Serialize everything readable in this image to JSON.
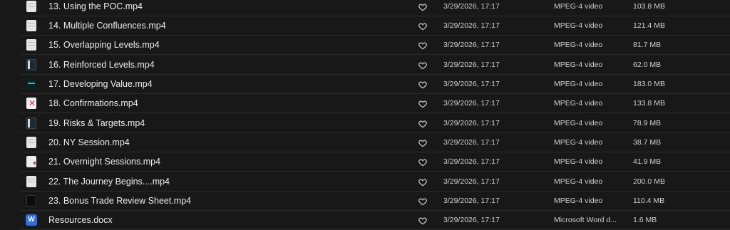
{
  "files": [
    {
      "name": "13. Using the POC.mp4",
      "modified": "3/29/2026, 17:17",
      "kind": "MPEG-4 video",
      "size": "103.8 MB",
      "thumb_icon": "video-thumbnail-icon"
    },
    {
      "name": "14. Multiple Confluences.mp4",
      "modified": "3/29/2026, 17:17",
      "kind": "MPEG-4 video",
      "size": "121.4 MB",
      "thumb_icon": "video-thumbnail-icon"
    },
    {
      "name": "15. Overlapping Levels.mp4",
      "modified": "3/29/2026, 17:17",
      "kind": "MPEG-4 video",
      "size": "81.7 MB",
      "thumb_icon": "video-thumbnail-icon"
    },
    {
      "name": "16. Reinforced Levels.mp4",
      "modified": "3/29/2026, 17:17",
      "kind": "MPEG-4 video",
      "size": "62.0 MB",
      "thumb_icon": "video-thumbnail-icon"
    },
    {
      "name": "17. Developing Value.mp4",
      "modified": "3/29/2026, 17:17",
      "kind": "MPEG-4 video",
      "size": "183.0 MB",
      "thumb_icon": "video-thumbnail-icon"
    },
    {
      "name": "18. Confirmations.mp4",
      "modified": "3/29/2026, 17:17",
      "kind": "MPEG-4 video",
      "size": "133.8 MB",
      "thumb_icon": "video-thumbnail-icon"
    },
    {
      "name": "19. Risks & Targets.mp4",
      "modified": "3/29/2026, 17:17",
      "kind": "MPEG-4 video",
      "size": "78.9 MB",
      "thumb_icon": "video-thumbnail-icon"
    },
    {
      "name": "20. NY Session.mp4",
      "modified": "3/29/2026, 17:17",
      "kind": "MPEG-4 video",
      "size": "38.7 MB",
      "thumb_icon": "video-thumbnail-icon"
    },
    {
      "name": "21. Overnight Sessions.mp4",
      "modified": "3/29/2026, 17:17",
      "kind": "MPEG-4 video",
      "size": "41.9 MB",
      "thumb_icon": "video-thumbnail-icon"
    },
    {
      "name": "22. The Journey Begins....mp4",
      "modified": "3/29/2026, 17:17",
      "kind": "MPEG-4 video",
      "size": "200.0 MB",
      "thumb_icon": "video-thumbnail-icon"
    },
    {
      "name": "23. Bonus Trade Review Sheet.mp4",
      "modified": "3/29/2026, 17:17",
      "kind": "MPEG-4 video",
      "size": "110.4 MB",
      "thumb_icon": "video-thumbnail-icon"
    },
    {
      "name": "Resources.docx",
      "modified": "3/29/2026, 17:17",
      "kind": "Microsoft Word d...",
      "size": "1.6 MB",
      "thumb_icon": "word-document-icon",
      "thumb_letter": "W"
    }
  ],
  "favorite_icon": "heart-icon",
  "colors": {
    "background": "#181818",
    "row_divider": "#2a2a2a",
    "text_primary": "#ececec",
    "text_secondary": "#cfcfcf",
    "word_blue": "#2f6ee0"
  }
}
